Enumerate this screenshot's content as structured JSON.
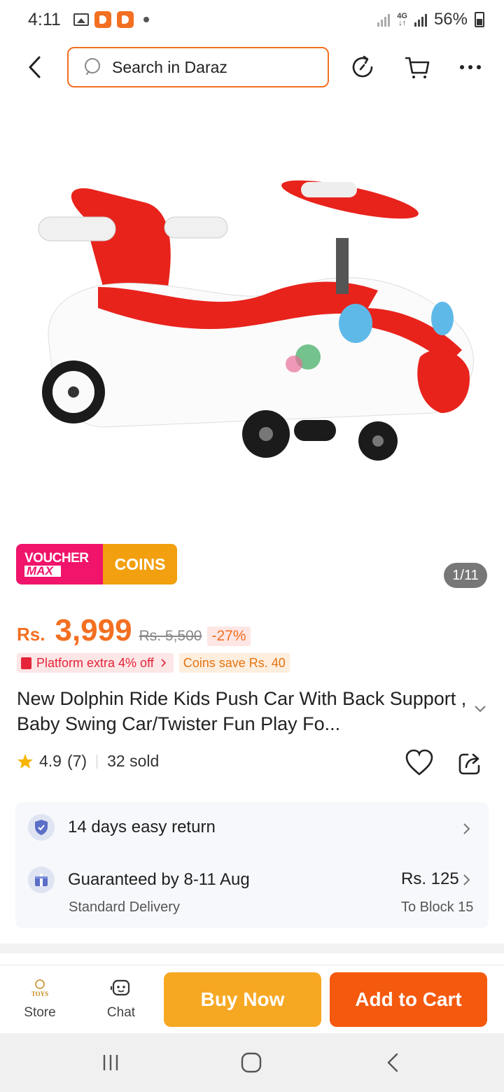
{
  "status_bar": {
    "time": "4:11",
    "network": "4G",
    "battery": "56%"
  },
  "header": {
    "search_placeholder": "Search in Daraz",
    "icons": [
      "back-icon",
      "search-icon",
      "history-refresh-icon",
      "cart-icon",
      "more-icon"
    ]
  },
  "gallery": {
    "counter": "1/11",
    "badges": {
      "voucher_top": "VOUCHER",
      "voucher_bottom": "MAX",
      "coins": "COINS"
    }
  },
  "price": {
    "currency": "Rs.",
    "current": "3,999",
    "original": "Rs. 5,500",
    "discount": "-27%"
  },
  "promos": {
    "platform": "Platform extra 4% off",
    "coins": "Coins save Rs. 40"
  },
  "product": {
    "title": "New Dolphin Ride Kids Push Car With Back Support , Baby Swing Car/Twister Fun Play Fo...",
    "rating": "4.9",
    "reviews": "(7)",
    "sold": "32 sold"
  },
  "service": {
    "return_text": "14 days easy return",
    "delivery_text": "Guaranteed by 8-11 Aug",
    "delivery_type": "Standard Delivery",
    "delivery_price": "Rs. 125",
    "delivery_location": "To Block 15"
  },
  "actions": {
    "store": "Store",
    "store_logo_text": "TOYS",
    "chat": "Chat",
    "buy_now": "Buy Now",
    "add_to_cart": "Add to Cart"
  },
  "colors": {
    "accent": "#f36f21",
    "buy_now": "#f7a823",
    "add_to_cart": "#f5590e",
    "voucher": "#f0146b",
    "coins": "#f2a00f"
  }
}
